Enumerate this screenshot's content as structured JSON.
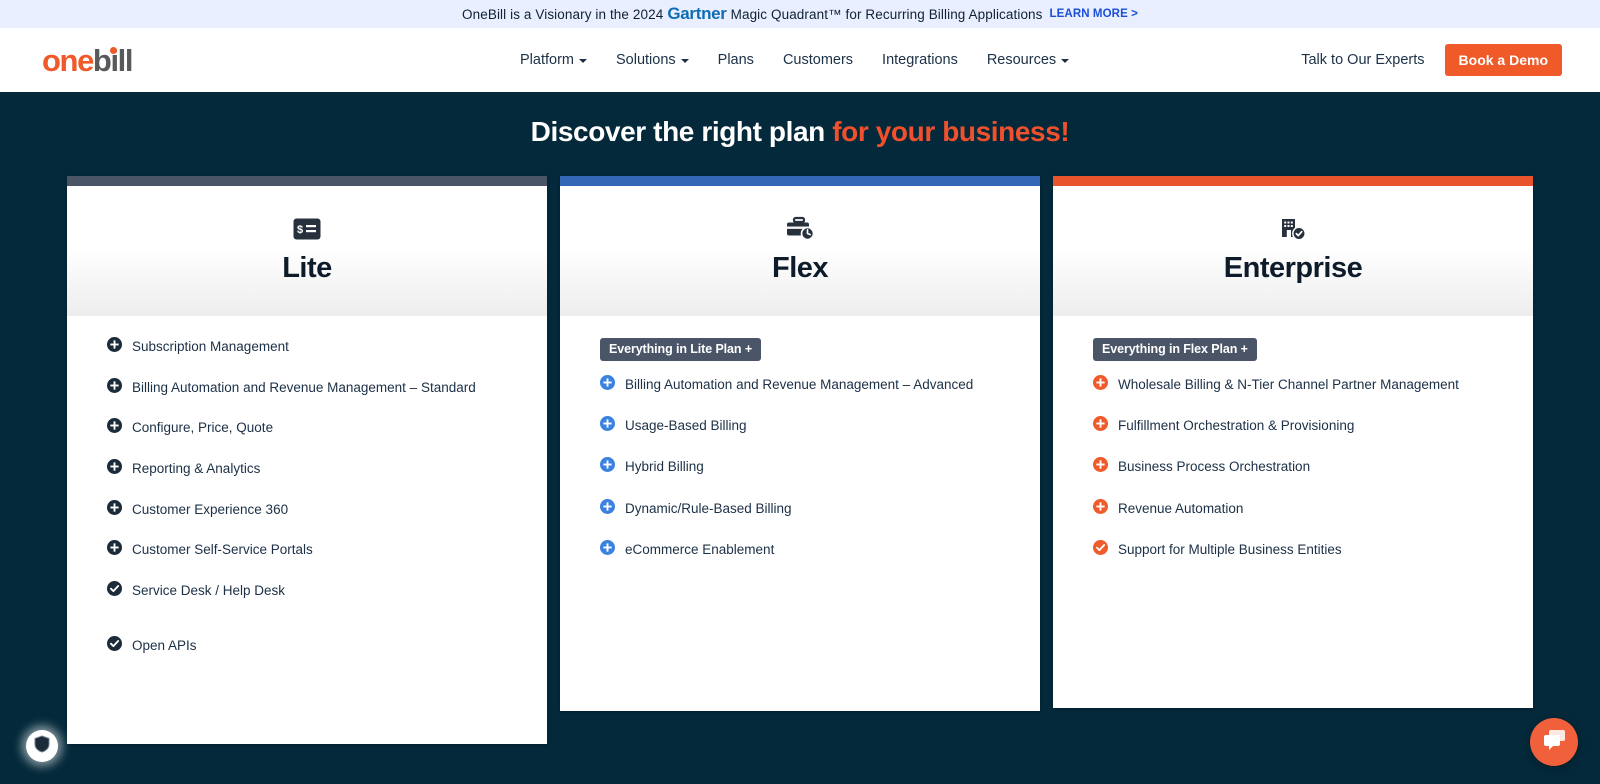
{
  "announcement": {
    "text_before": "OneBill is a Visionary in the 2024",
    "brand": "Gartner",
    "text_after": "Magic Quadrant™ for Recurring Billing Applications",
    "link": "LEARN MORE >"
  },
  "header": {
    "logo_one": "one",
    "logo_bill": "bill",
    "nav": [
      {
        "label": "Platform",
        "has_caret": true
      },
      {
        "label": "Solutions",
        "has_caret": true
      },
      {
        "label": "Plans",
        "has_caret": false
      },
      {
        "label": "Customers",
        "has_caret": false
      },
      {
        "label": "Integrations",
        "has_caret": false
      },
      {
        "label": "Resources",
        "has_caret": true
      }
    ],
    "talk_label": "Talk to Our Experts",
    "demo_label": "Book a Demo"
  },
  "hero": {
    "title_white": "Discover the right plan ",
    "title_orange": "for your business!"
  },
  "colors": {
    "page_background": "#04293a",
    "brand_orange": "#f05a28",
    "lite_bar": "#4a5568",
    "flex_bar": "#3267b5",
    "enterprise_bar": "#e8552c",
    "announcement_bg": "#e9efff",
    "gartner_blue": "#0f6cb4",
    "link_blue": "#1a4fd6"
  },
  "plans": [
    {
      "key": "lite",
      "name": "Lite",
      "icon": "invoice-dollar-icon",
      "bar_color": "#4a5568",
      "icon_color": "#1c2b3a",
      "badge": null,
      "features": [
        {
          "label": "Subscription Management",
          "icon": "plus-circle-icon"
        },
        {
          "label": "Billing Automation and Revenue Management – Standard",
          "icon": "plus-circle-icon"
        },
        {
          "label": "Configure, Price, Quote",
          "icon": "plus-circle-icon"
        },
        {
          "label": "Reporting & Analytics",
          "icon": "plus-circle-icon"
        },
        {
          "label": "Customer Experience 360",
          "icon": "plus-circle-icon"
        },
        {
          "label": "Customer Self-Service Portals",
          "icon": "plus-circle-icon"
        },
        {
          "label": "Service Desk / Help Desk",
          "icon": "check-circle-icon"
        },
        {
          "label": "Open APIs",
          "icon": "check-circle-icon"
        }
      ]
    },
    {
      "key": "flex",
      "name": "Flex",
      "icon": "briefcase-clock-icon",
      "bar_color": "#3267b5",
      "icon_color": "#3b82e0",
      "badge": "Everything in Lite Plan +",
      "features": [
        {
          "label": "Billing Automation and Revenue Management – Advanced",
          "icon": "plus-circle-icon"
        },
        {
          "label": "Usage-Based Billing",
          "icon": "plus-circle-icon"
        },
        {
          "label": "Hybrid Billing",
          "icon": "plus-circle-icon"
        },
        {
          "label": "Dynamic/Rule-Based Billing",
          "icon": "plus-circle-icon"
        },
        {
          "label": "eCommerce Enablement",
          "icon": "plus-circle-icon"
        }
      ]
    },
    {
      "key": "enterprise",
      "name": "Enterprise",
      "icon": "building-check-icon",
      "bar_color": "#e8552c",
      "icon_color": "#ef5b2b",
      "badge": "Everything in Flex Plan +",
      "features": [
        {
          "label": "Wholesale Billing & N-Tier Channel Partner Management",
          "icon": "plus-circle-icon"
        },
        {
          "label": "Fulfillment Orchestration & Provisioning",
          "icon": "plus-circle-icon"
        },
        {
          "label": "Business Process Orchestration",
          "icon": "plus-circle-icon"
        },
        {
          "label": "Revenue Automation",
          "icon": "plus-circle-icon"
        },
        {
          "label": "Support for Multiple Business Entities",
          "icon": "check-circle-icon"
        }
      ]
    }
  ],
  "widgets": {
    "shield": "security-shield-icon",
    "chat": "chat-bubble-icon"
  }
}
